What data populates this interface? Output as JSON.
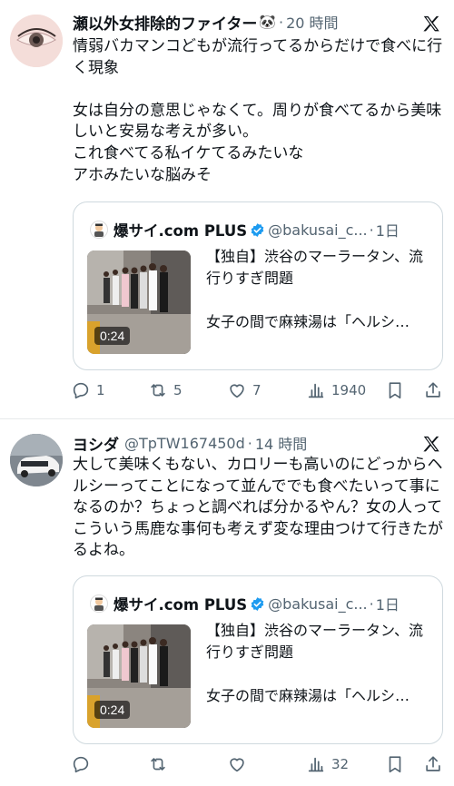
{
  "tweets": [
    {
      "display_name": "瀬以外女排除的ファイター",
      "name_emoji": "🐼",
      "handle": "",
      "time": "20 時間",
      "text": "情弱バカマンコどもが流行ってるからだけで食べに行く現象\n\n女は自分の意思じゃなくて。周りが食べてるから美味しいと安易な考えが多い。\nこれ食べてる私イケてるみたいな\nアホみたいな脳みそ",
      "quote": {
        "display_name": "爆サイ.com PLUS",
        "handle": "@bakusai_c...",
        "time": "1日",
        "title": "【独自】渋谷のマーラータン、流行りすぎ問題",
        "excerpt": "女子の間で麻辣湯は「ヘルシ…",
        "duration": "0:24"
      },
      "actions": {
        "replies": "1",
        "retweets": "5",
        "likes": "7",
        "views": "1940"
      }
    },
    {
      "display_name": "ヨシダ",
      "name_emoji": "",
      "handle": "@TpTW167450d",
      "time": "14 時間",
      "text": "大して美味くもない、カロリーも高いのにどっからヘルシーってことになって並んででも食べたいって事になるのか？ちょっと調べれば分かるやん？女の人ってこういう馬鹿な事何も考えず変な理由つけて行きたがるよね。",
      "quote": {
        "display_name": "爆サイ.com PLUS",
        "handle": "@bakusai_c...",
        "time": "1日",
        "title": "【独自】渋谷のマーラータン、流行りすぎ問題",
        "excerpt": "女子の間で麻辣湯は「ヘルシ…",
        "duration": "0:24"
      },
      "actions": {
        "replies": "",
        "retweets": "",
        "likes": "",
        "views": "32"
      }
    }
  ],
  "colors": {
    "text": "#0f1419",
    "secondary": "#536471",
    "border": "#cfd9de",
    "verified": "#1d9bf0"
  },
  "icons": [
    "x-logo-icon",
    "verified-badge-icon",
    "reply-icon",
    "retweet-icon",
    "like-icon",
    "views-icon",
    "bookmark-icon",
    "share-icon"
  ]
}
